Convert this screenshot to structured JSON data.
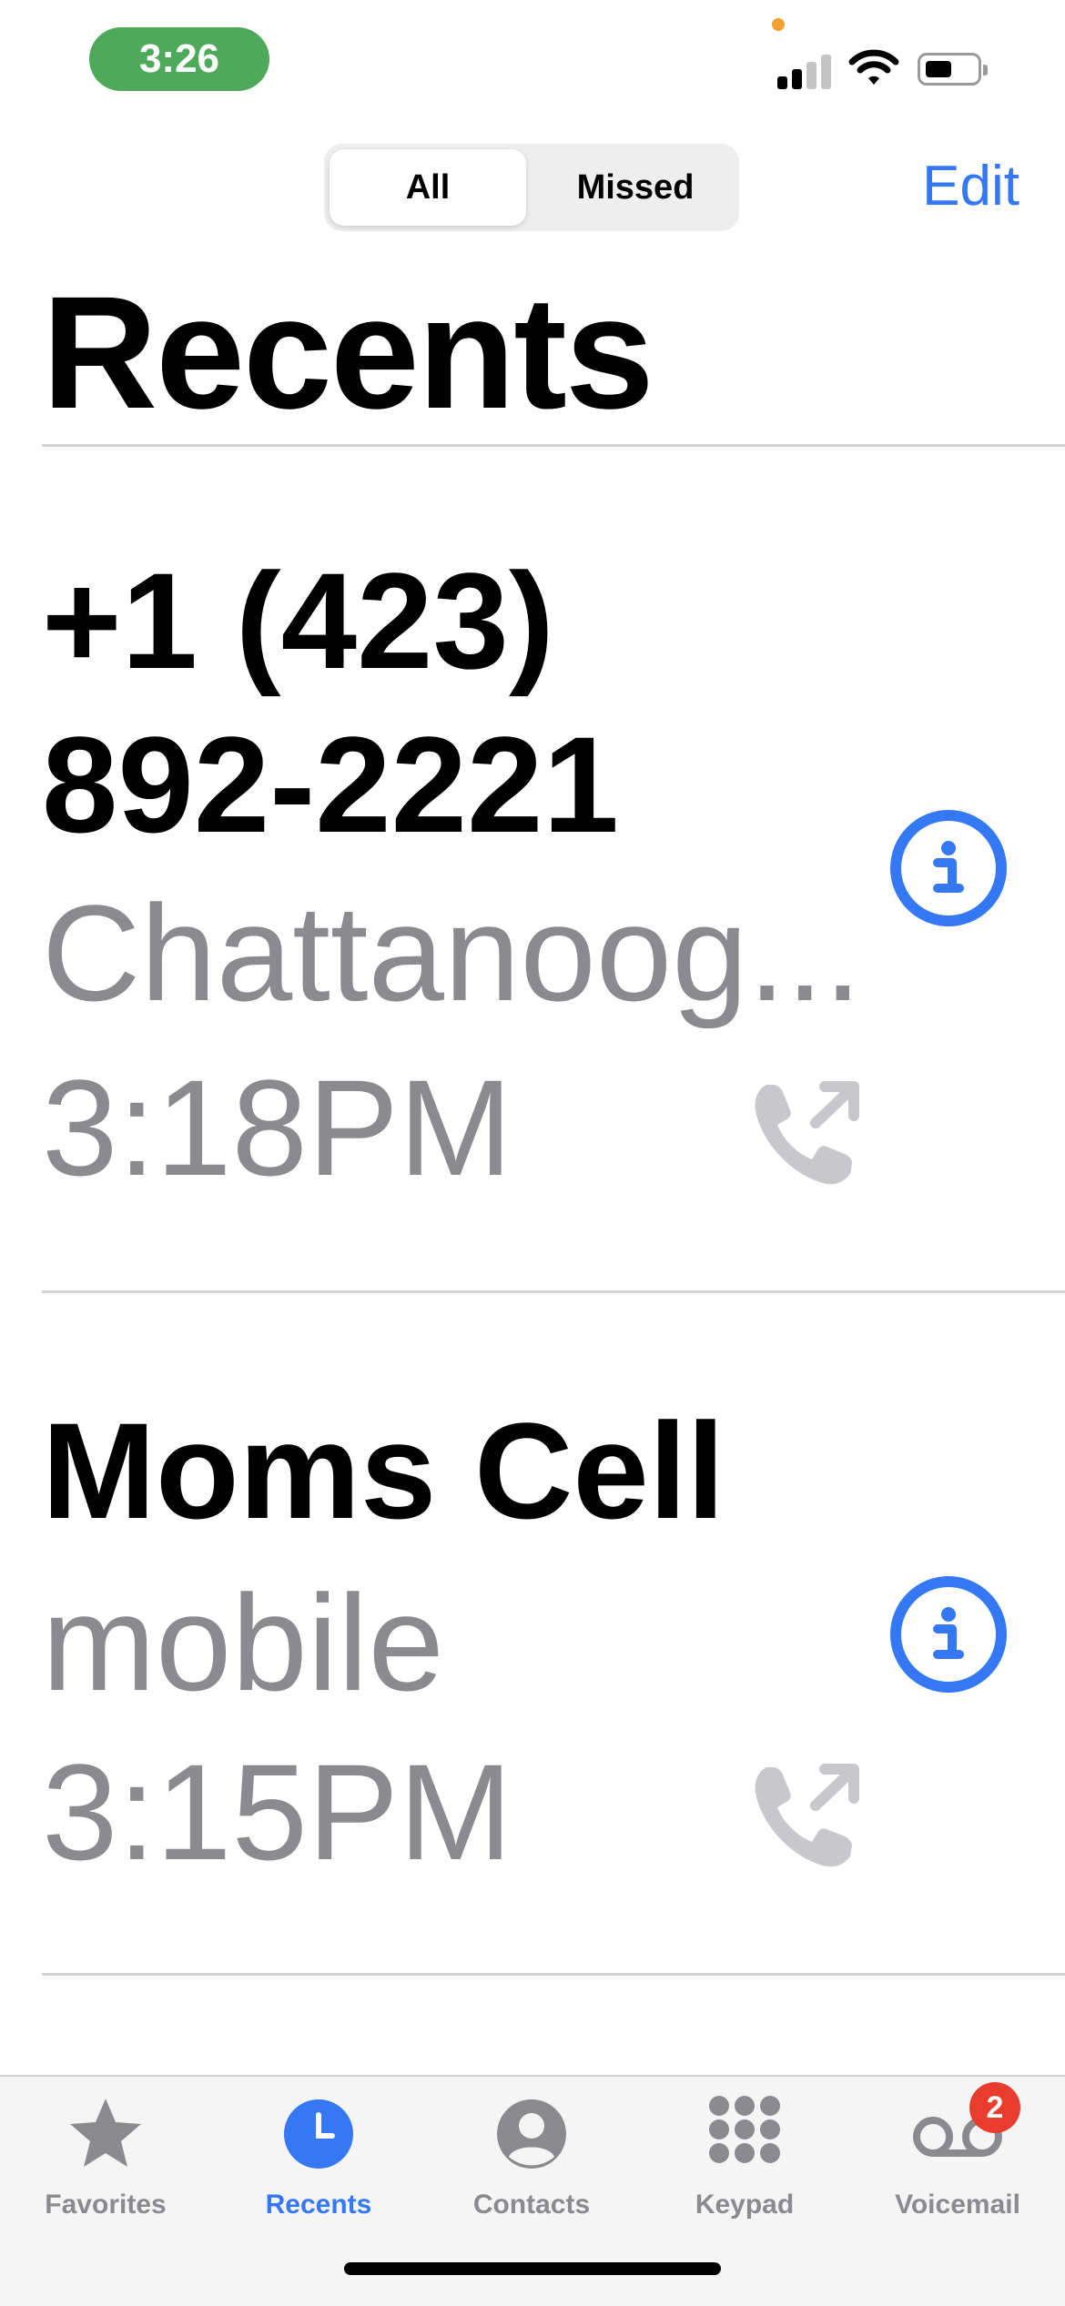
{
  "status_bar": {
    "time": "3:26"
  },
  "segments": {
    "all": "All",
    "missed": "Missed",
    "selected": "All"
  },
  "header": {
    "edit_label": "Edit",
    "title": "Recents"
  },
  "calls": [
    {
      "name": "+1 (423) 892-2221",
      "sub": "Chattanoog...",
      "time": "3:18PM",
      "type": "outgoing"
    },
    {
      "name": "Moms Cell",
      "sub": "mobile",
      "time": "3:15PM",
      "type": "outgoing"
    }
  ],
  "tabs": [
    {
      "label": "Favorites",
      "icon": "star-icon"
    },
    {
      "label": "Recents",
      "icon": "clock-icon",
      "active": true
    },
    {
      "label": "Contacts",
      "icon": "person-circle-icon"
    },
    {
      "label": "Keypad",
      "icon": "keypad-icon"
    },
    {
      "label": "Voicemail",
      "icon": "voicemail-icon",
      "badge": "2"
    }
  ],
  "colors": {
    "accent": "#3478f6",
    "secondary_text": "#8b8b8f",
    "badge": "#ea3c2e",
    "time_pill": "#4fa95a"
  }
}
